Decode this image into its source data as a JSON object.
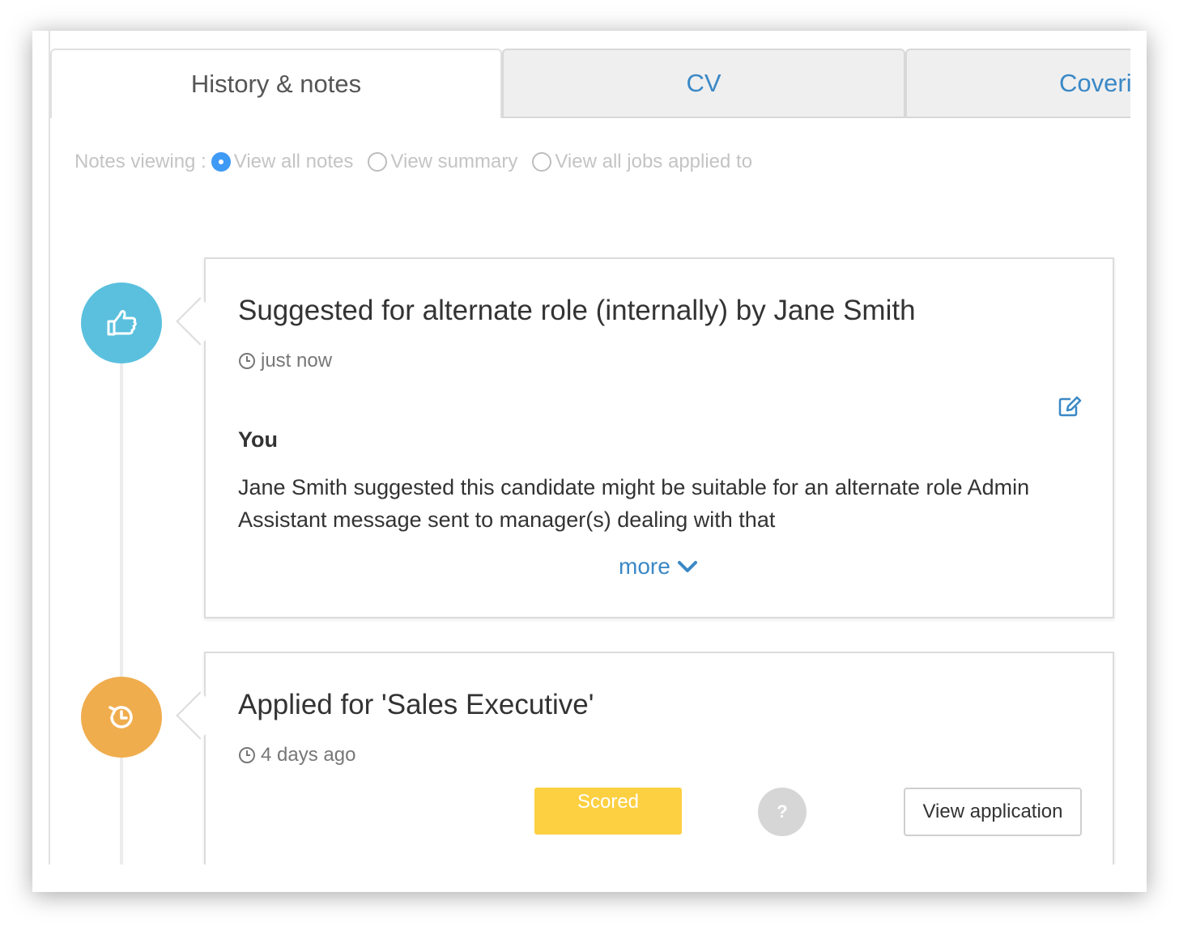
{
  "tabs": [
    {
      "label": "History & notes",
      "active": true
    },
    {
      "label": "CV",
      "active": false
    },
    {
      "label": "Coveri",
      "active": false
    }
  ],
  "notes_viewing": {
    "label": "Notes viewing :",
    "options": [
      {
        "label": "View all notes",
        "checked": true
      },
      {
        "label": "View summary",
        "checked": false
      },
      {
        "label": "View all jobs applied to",
        "checked": false
      }
    ]
  },
  "timeline": [
    {
      "icon": "thumbs-up-icon",
      "color": "#5bc0de",
      "title": "Suggested for alternate role (internally) by Jane Smith",
      "time": "just now",
      "author": "You",
      "text": "Jane Smith suggested this candidate might be suitable for an alternate role Admin Assistant message sent to manager(s) dealing with that",
      "more_label": "more"
    },
    {
      "icon": "history-icon",
      "color": "#f0ad4e",
      "title": "Applied for 'Sales Executive'",
      "time": "4 days ago",
      "scored_label": "Scored",
      "help_label": "?",
      "view_label": "View application"
    }
  ],
  "colors": {
    "link": "#3a88c6",
    "radio_checked": "#3e9af5",
    "scored": "#fdd042"
  }
}
